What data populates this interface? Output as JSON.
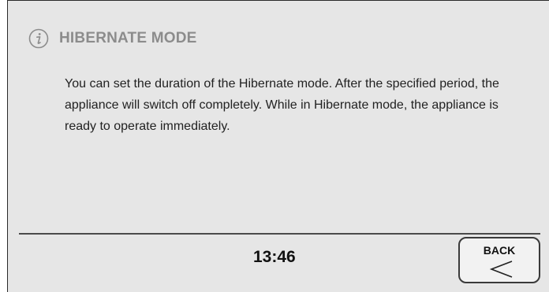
{
  "dialog": {
    "title": "HIBERNATE MODE",
    "icon": "info-icon",
    "message": "You can set the duration of the Hibernate mode. After the specified period, the appliance will switch off completely. While in Hibernate mode, the appliance is ready to operate immediately."
  },
  "footer": {
    "time": "13:46",
    "back_label": "BACK",
    "back_icon": "chevron-left-icon"
  },
  "colors": {
    "background": "#e6e6e6",
    "title": "#8c8c8c",
    "text": "#222222"
  }
}
